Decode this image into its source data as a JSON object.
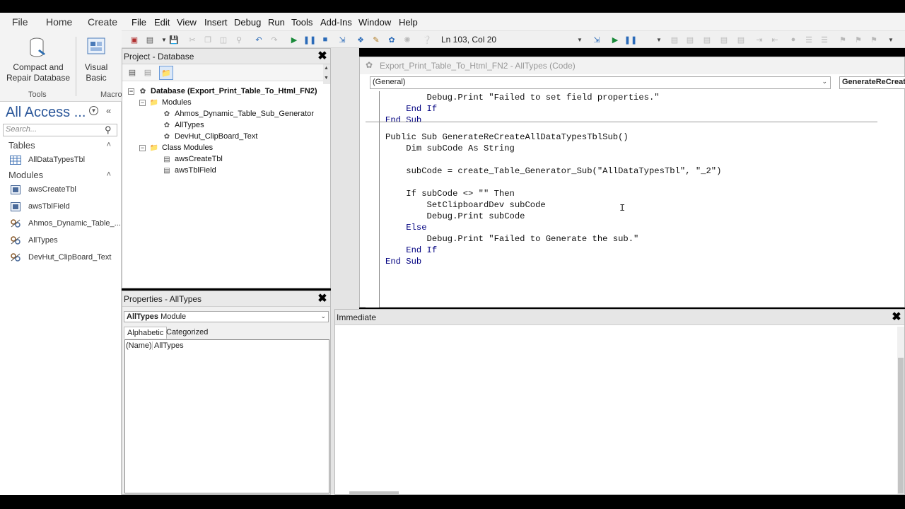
{
  "access": {
    "ribbon_tabs": [
      "File",
      "Home",
      "Create"
    ],
    "ribbon": {
      "compact_label_1": "Compact and",
      "compact_label_2": "Repair Database",
      "vb_label_1": "Visual",
      "vb_label_2": "Basic",
      "group_tools": "Tools",
      "group_macro": "Macro"
    },
    "nav": {
      "title": "All Access ...",
      "search_placeholder": "Search...",
      "tables_header": "Tables",
      "tables": [
        "AllDataTypesTbl"
      ],
      "modules_header": "Modules",
      "modules": [
        "awsCreateTbl",
        "awsTblField",
        "Ahmos_Dynamic_Table_...",
        "AllTypes",
        "DevHut_ClipBoard_Text"
      ]
    }
  },
  "vbe": {
    "menu": [
      "File",
      "Edit",
      "View",
      "Insert",
      "Debug",
      "Run",
      "Tools",
      "Add-Ins",
      "Window",
      "Help"
    ],
    "cursor_position": "Ln 103, Col 20",
    "project": {
      "title": "Project - Database",
      "root": "Database (Export_Print_Table_To_Html_FN2)",
      "modules_folder": "Modules",
      "modules": [
        "Ahmos_Dynamic_Table_Sub_Generator",
        "AllTypes",
        "DevHut_ClipBoard_Text"
      ],
      "class_folder": "Class Modules",
      "classes": [
        "awsCreateTbl",
        "awsTblField"
      ]
    },
    "properties": {
      "title": "Properties - AllTypes",
      "object": "AllTypes",
      "object_type": "Module",
      "tab_alpha": "Alphabetic",
      "tab_cat": "Categorized",
      "prop_name": "(Name)",
      "prop_value": "AllTypes"
    },
    "code": {
      "title": "Export_Print_Table_To_Html_FN2 - AllTypes (Code)",
      "combo_left": "(General)",
      "combo_right": "GenerateReCreateAllDataTypesTblSub",
      "lines": [
        "        Debug.Print \"Failed to set field properties.\"",
        "    End If",
        "End Sub",
        "",
        "Public Sub GenerateReCreateAllDataTypesTblSub()",
        "    Dim subCode As String",
        "",
        "    subCode = create_Table_Generator_Sub(\"AllDataTypesTbl\", \"_2\")",
        "",
        "    If subCode <> \"\" Then",
        "        SetClipboardDev subCode",
        "        Debug.Print subCode",
        "    Else",
        "        Debug.Print \"Failed to Generate the sub.\"",
        "    End If",
        "End Sub"
      ]
    },
    "immediate": {
      "title": "Immediate"
    }
  },
  "colors": {
    "nav_title": "#2b579a",
    "keyword": "#000080"
  }
}
